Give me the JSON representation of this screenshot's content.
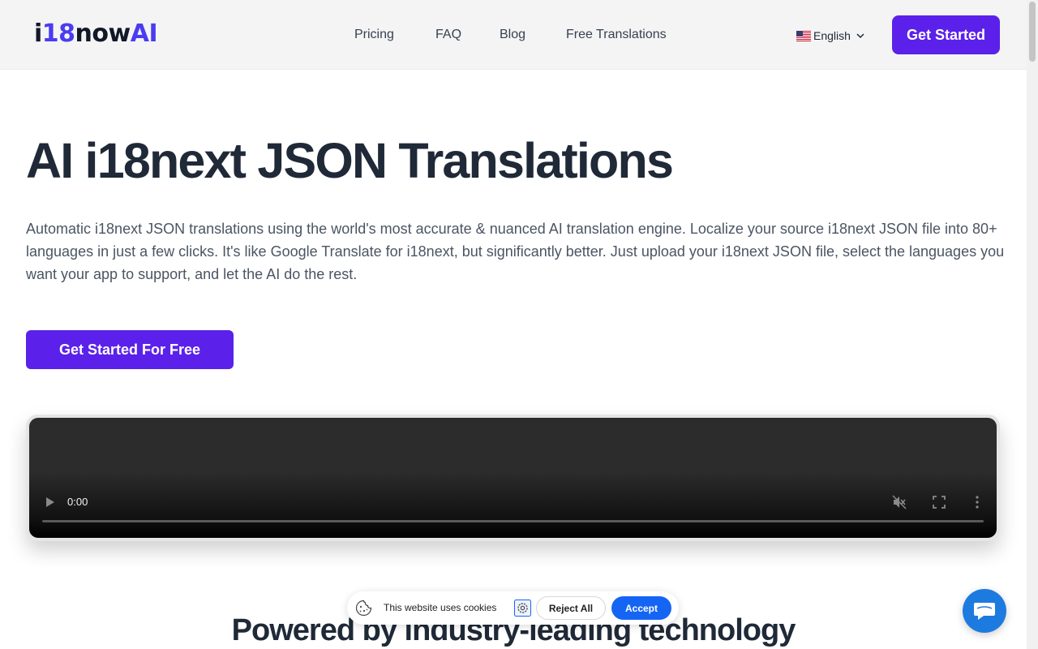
{
  "header": {
    "logo": {
      "part1": "i",
      "part2": "18",
      "part3": "now",
      "part4": "AI"
    },
    "nav": [
      {
        "label": "Pricing"
      },
      {
        "label": "FAQ"
      },
      {
        "label": "Blog"
      },
      {
        "label": "Free Translations"
      }
    ],
    "language": {
      "label": "English",
      "flag_icon": "us-flag-icon"
    },
    "cta_label": "Get Started"
  },
  "hero": {
    "title": "AI i18next JSON Translations",
    "description": "Automatic i18next JSON translations using the world's most accurate & nuanced AI translation engine. Localize your source i18next JSON file into 80+ languages in just a few clicks. It's like Google Translate for i18next, but significantly better. Just upload your i18next JSON file, select the languages you want your app to support, and let the AI do the rest.",
    "cta_label": "Get Started For Free"
  },
  "video": {
    "time": "0:00",
    "progress": 0
  },
  "section": {
    "title": "Powered by industry-leading technology"
  },
  "cookie_banner": {
    "text": "This website uses cookies",
    "reject_label": "Reject All",
    "accept_label": "Accept"
  },
  "colors": {
    "brand": "#5b21ea",
    "logo_accent": "#4a3cf2",
    "accept": "#1565f5",
    "chat": "#1d7be0"
  }
}
